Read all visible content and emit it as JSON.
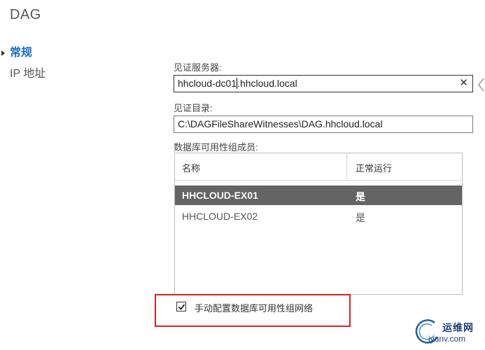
{
  "window": {
    "title": "DAG"
  },
  "nav": {
    "items": [
      {
        "label": "常规"
      },
      {
        "label": "IP 地址"
      }
    ]
  },
  "form": {
    "witness_server": {
      "label": "见证服务器:",
      "value_before_caret": "hhcloud-dc01",
      "value_after_caret": ".hhcloud.local"
    },
    "witness_directory": {
      "label": "见证目录:",
      "value": "C:\\DAGFileShareWitnesses\\DAG.hhcloud.local"
    },
    "members": {
      "label": "数据库可用性组成员:",
      "columns": [
        "名称",
        "正常运行"
      ],
      "rows": [
        {
          "name": "HHCLOUD-EX01",
          "status": "是"
        },
        {
          "name": "HHCLOUD-EX02",
          "status": "是"
        }
      ]
    },
    "manual_config": {
      "label": "手动配置数据库可用性组网络",
      "checked": true
    }
  },
  "watermark": {
    "name": "运维网",
    "url": "iyunv.com"
  },
  "colors": {
    "accent": "#1c6dc2",
    "selected_row": "#646464",
    "highlight": "#e02020"
  }
}
